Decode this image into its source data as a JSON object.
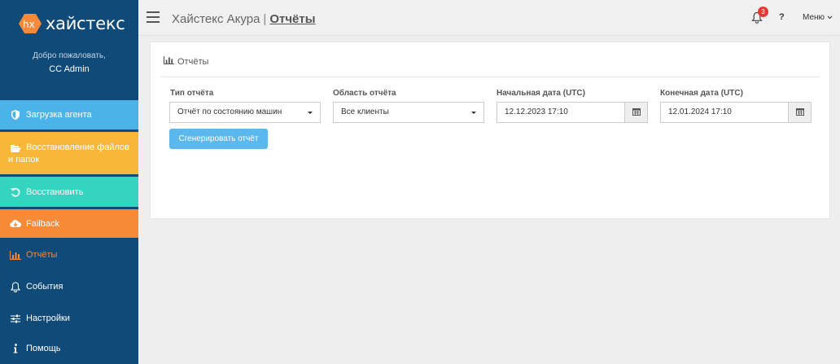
{
  "brand": {
    "logo_mark": "hx",
    "logo_text": "хайстекс",
    "logo_color": "#f7893a"
  },
  "sidebar": {
    "welcome": "Добро пожаловать,",
    "user": "CC Admin",
    "items": [
      {
        "label": "Загрузка агента",
        "icon": "shield-icon",
        "color": "#4cb3e8"
      },
      {
        "label": "Восстановление файлов и папок",
        "icon": "folder-open-icon",
        "color": "#f8b739"
      },
      {
        "label": "Восстановить",
        "icon": "undo-icon",
        "color": "#33d5be"
      },
      {
        "label": "Failback",
        "icon": "cloud-download-icon",
        "color": "#f78a37"
      },
      {
        "label": "Отчёты",
        "icon": "bar-chart-icon",
        "active": true
      },
      {
        "label": "События",
        "icon": "bell-icon"
      },
      {
        "label": "Настройки",
        "icon": "sliders-icon"
      },
      {
        "label": "Помощь",
        "icon": "info-icon"
      }
    ]
  },
  "header": {
    "app_name": "Хайстекс Акура",
    "separator": "|",
    "page": "Отчёты",
    "notifications_count": "3",
    "help": "?",
    "menu_label": "Меню"
  },
  "card": {
    "title": "Отчёты",
    "report_type": {
      "label": "Тип отчёта",
      "value": "Отчёт по состоянию машин"
    },
    "report_scope": {
      "label": "Область отчёта",
      "value": "Все клиенты"
    },
    "start_date": {
      "label": "Начальная дата (UTC)",
      "value": "12.12.2023 17:10"
    },
    "end_date": {
      "label": "Конечная дата (UTC)",
      "value": "12.01.2024 17:10"
    },
    "generate_label": "Сгенерировать отчёт"
  }
}
